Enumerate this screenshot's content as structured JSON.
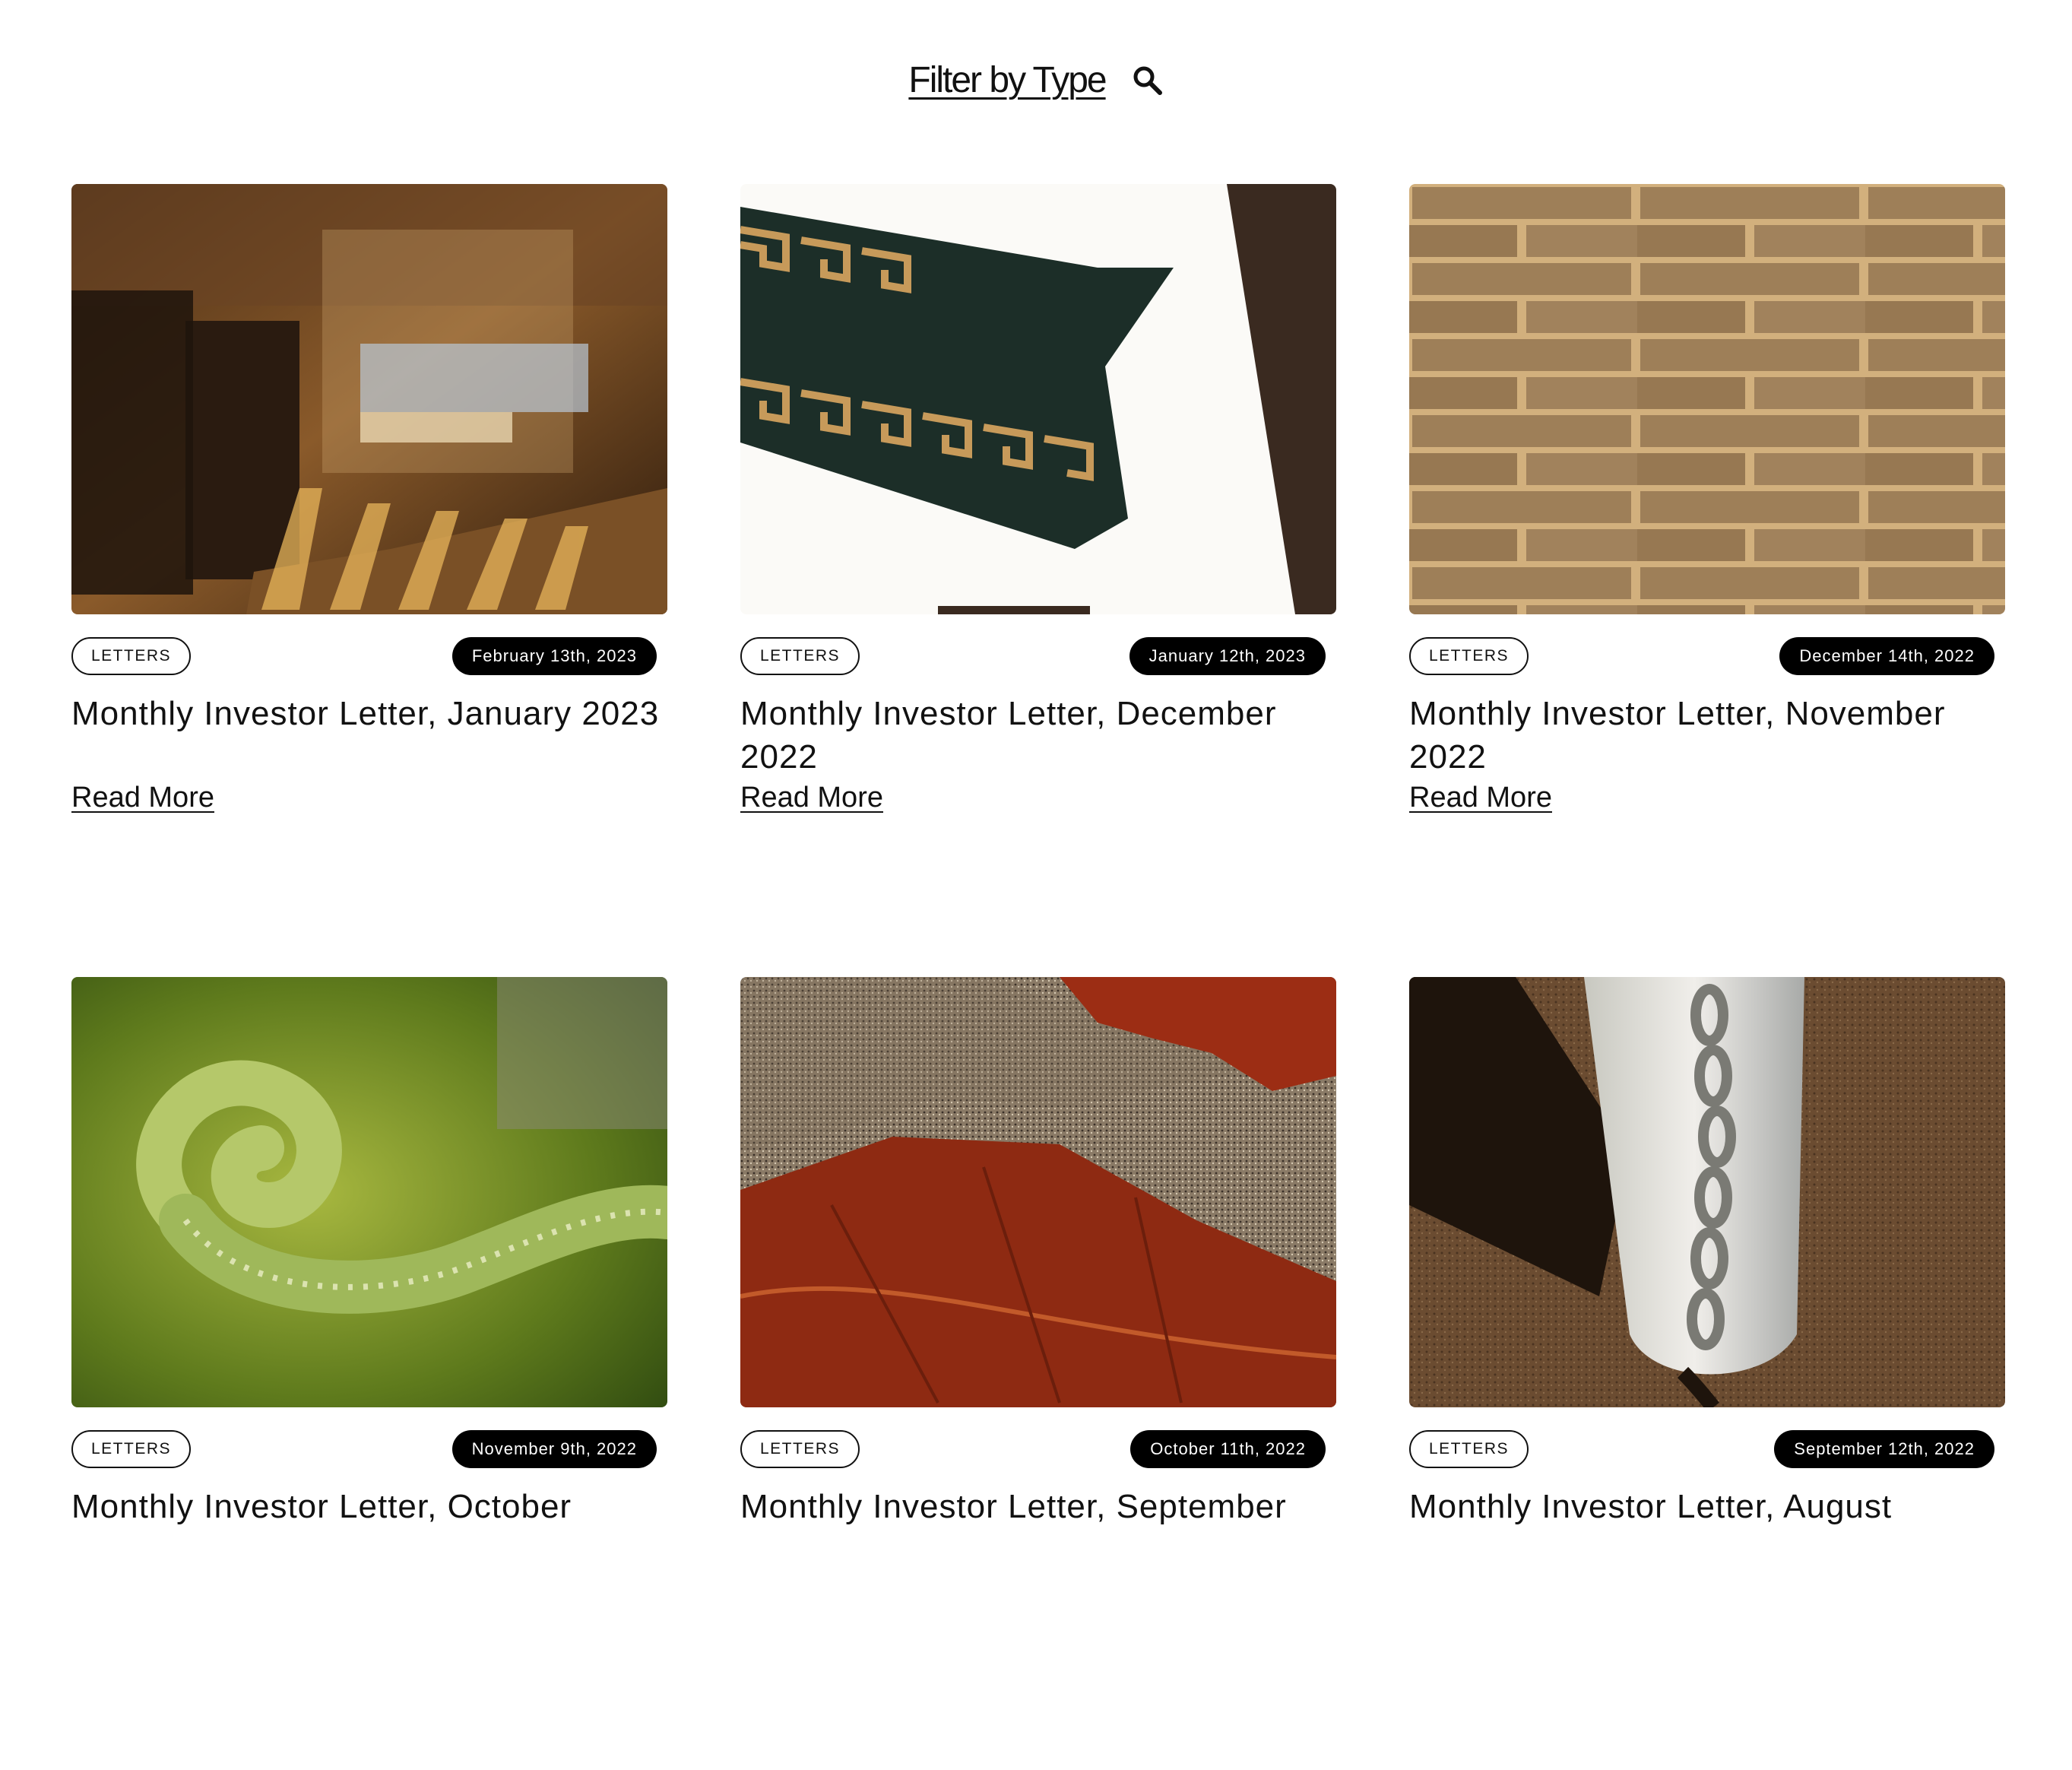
{
  "filter": {
    "label": "Filter by Type",
    "icon": "search-icon"
  },
  "posts": [
    {
      "type": "LETTERS",
      "date": "February 13th, 2023",
      "title": "Monthly Investor Letter, January 2023",
      "link": "Read More",
      "image": "store-interior-sunlight"
    },
    {
      "type": "LETTERS",
      "date": "January 12th, 2023",
      "title": "Monthly Investor Letter, December 2022",
      "link": "Read More",
      "image": "greek-key-banner"
    },
    {
      "type": "LETTERS",
      "date": "December 14th, 2022",
      "title": "Monthly Investor Letter, November 2022",
      "link": "Read More",
      "image": "brick-wall"
    },
    {
      "type": "LETTERS",
      "date": "November 9th, 2022",
      "title": "Monthly Investor Letter, October",
      "link": "",
      "image": "fern-fiddlehead"
    },
    {
      "type": "LETTERS",
      "date": "October 11th, 2022",
      "title": "Monthly Investor Letter, September",
      "link": "",
      "image": "red-leaf-on-pavement"
    },
    {
      "type": "LETTERS",
      "date": "September 12th, 2022",
      "title": "Monthly Investor Letter, August",
      "link": "",
      "image": "white-post-chain-shadow"
    }
  ]
}
